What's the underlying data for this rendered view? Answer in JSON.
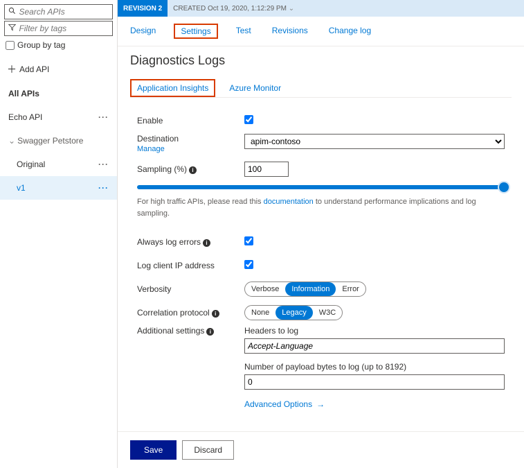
{
  "sidebar": {
    "search_placeholder": "Search APIs",
    "filter_placeholder": "Filter by tags",
    "group_by_tag": "Group by tag",
    "add_api": "Add API",
    "all_apis": "All APIs",
    "items": [
      {
        "label": "Echo API"
      },
      {
        "label": "Swagger Petstore"
      },
      {
        "label": "Original"
      },
      {
        "label": "v1"
      }
    ]
  },
  "revbar": {
    "badge": "REVISION 2",
    "created": "CREATED Oct 19, 2020, 1:12:29 PM"
  },
  "tabs": {
    "design": "Design",
    "settings": "Settings",
    "test": "Test",
    "revisions": "Revisions",
    "changelog": "Change log"
  },
  "page_title": "Diagnostics Logs",
  "subtabs": {
    "ai": "Application Insights",
    "am": "Azure Monitor"
  },
  "form": {
    "enable": "Enable",
    "destination": "Destination",
    "destination_value": "apim-contoso",
    "manage": "Manage",
    "sampling": "Sampling (%)",
    "sampling_value": "100",
    "help_pre": "For high traffic APIs, please read this ",
    "help_link": "documentation",
    "help_post": " to understand performance implications and log sampling.",
    "always_log": "Always log errors",
    "log_ip": "Log client IP address",
    "verbosity": "Verbosity",
    "verbosity_opts": {
      "verbose": "Verbose",
      "information": "Information",
      "error": "Error"
    },
    "corr": "Correlation protocol",
    "corr_opts": {
      "none": "None",
      "legacy": "Legacy",
      "w3c": "W3C"
    },
    "additional": "Additional settings",
    "headers_label": "Headers to log",
    "headers_value": "Accept-Language",
    "payload_label": "Number of payload bytes to log (up to 8192)",
    "payload_value": "0",
    "advanced": "Advanced Options"
  },
  "footer": {
    "save": "Save",
    "discard": "Discard"
  }
}
